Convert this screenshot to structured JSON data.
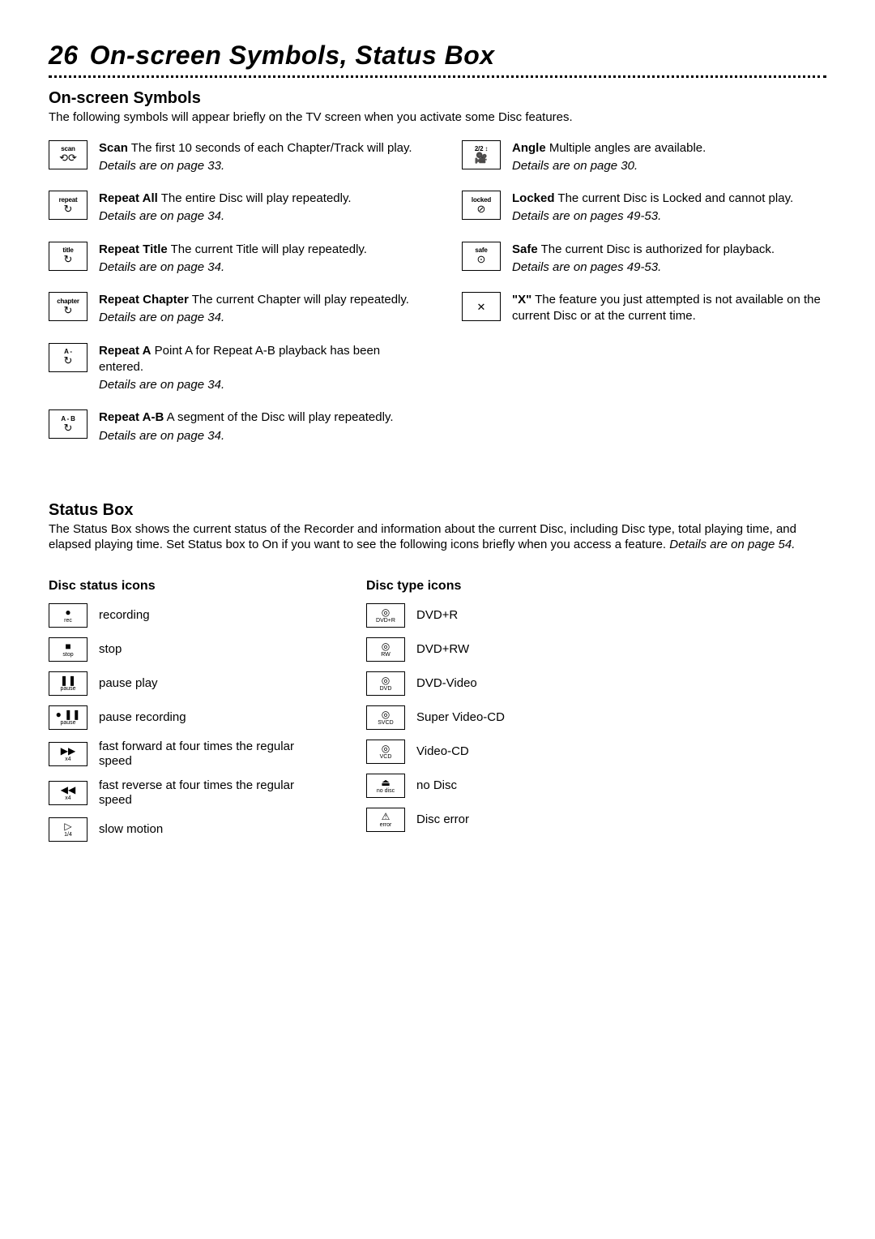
{
  "page_number": "26",
  "page_title": "On-screen Symbols, Status Box",
  "symbols_section": {
    "heading": "On-screen Symbols",
    "intro": "The following symbols will appear briefly on the TV screen when you activate some Disc features.",
    "left": [
      {
        "icon_label": "scan",
        "icon_glyph": "⟲⟳",
        "lead": "Scan",
        "body": " The first 10 seconds of each Chapter/Track will play.",
        "details": "Details are on page 33."
      },
      {
        "icon_label": "repeat",
        "icon_glyph": "↻",
        "lead": "Repeat All",
        "body": " The entire Disc will play repeatedly.",
        "details": "Details are on page 34."
      },
      {
        "icon_label": "title",
        "icon_glyph": "↻",
        "lead": "Repeat Title",
        "body": " The current Title will play repeatedly.",
        "details": "Details are on page 34."
      },
      {
        "icon_label": "chapter",
        "icon_glyph": "↻",
        "lead": "Repeat Chapter",
        "body": " The current Chapter will play repeatedly.",
        "details": "Details are on page 34."
      },
      {
        "icon_label": "A -",
        "icon_glyph": "↻",
        "lead": "Repeat A",
        "body": " Point A for Repeat A-B playback has been entered.",
        "details": "Details are on page 34."
      },
      {
        "icon_label": "A - B",
        "icon_glyph": "↻",
        "lead": "Repeat A-B",
        "body": " A segment of the Disc will play repeatedly.",
        "details": "Details are on page 34."
      }
    ],
    "right": [
      {
        "icon_label": "2/2 ↕",
        "icon_glyph": "🎥",
        "lead": "Angle",
        "body": " Multiple angles are available.",
        "details": "Details are on page 30."
      },
      {
        "icon_label": "locked",
        "icon_glyph": "⊘",
        "lead": "Locked",
        "body": " The current Disc is Locked and cannot play.",
        "details": "Details are on pages 49-53."
      },
      {
        "icon_label": "safe",
        "icon_glyph": "⊙",
        "lead": "Safe",
        "body": " The current Disc is authorized for playback.",
        "details": "Details are on pages 49-53."
      },
      {
        "icon_label": "",
        "icon_glyph": "✕",
        "lead": "\"X\"",
        "body": " The feature you just attempted is not available on the current Disc or at the current time.",
        "details": ""
      }
    ]
  },
  "status_section": {
    "heading": "Status Box",
    "intro_main": "The Status Box shows the current status of the Recorder and information about the current Disc, including Disc type, total playing time, and elapsed playing time. Set Status box to On if you want to see the following icons briefly when you access a feature. ",
    "intro_ref": "Details are on page 54.",
    "disc_status_heading": "Disc status icons",
    "disc_type_heading": "Disc type icons",
    "disc_status": [
      {
        "g": "●",
        "sub": "rec",
        "text": "recording"
      },
      {
        "g": "■",
        "sub": "stop",
        "text": "stop"
      },
      {
        "g": "❚❚",
        "sub": "pause",
        "text": "pause play"
      },
      {
        "g": "● ❚❚",
        "sub": "pause",
        "text": "pause recording"
      },
      {
        "g": "▶▶",
        "sub": "x4",
        "text": "fast forward at four times the regular speed"
      },
      {
        "g": "◀◀",
        "sub": "x4",
        "text": "fast reverse at four times the regular speed"
      },
      {
        "g": "▷",
        "sub": "1/4",
        "text": "slow motion"
      }
    ],
    "disc_type": [
      {
        "g": "◎",
        "sub": "DVD+R",
        "text": "DVD+R"
      },
      {
        "g": "◎",
        "sub": "RW",
        "text": "DVD+RW"
      },
      {
        "g": "◎",
        "sub": "DVD",
        "text": "DVD-Video"
      },
      {
        "g": "◎",
        "sub": "SVCD",
        "text": "Super Video-CD"
      },
      {
        "g": "◎",
        "sub": "VCD",
        "text": "Video-CD"
      },
      {
        "g": "⏏",
        "sub": "no disc",
        "text": "no Disc"
      },
      {
        "g": "⚠",
        "sub": "error",
        "text": "Disc error"
      }
    ]
  }
}
